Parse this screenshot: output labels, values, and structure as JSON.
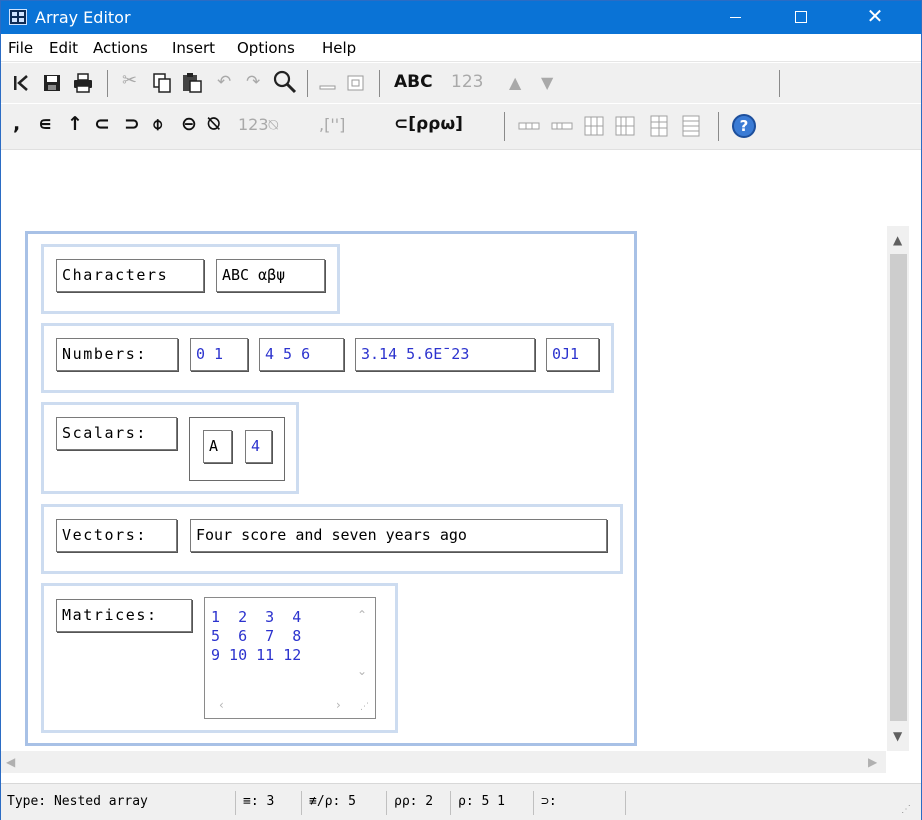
{
  "window": {
    "title": "Array Editor",
    "controls": {
      "minimize": "—",
      "maximize": "☐",
      "close": "✕"
    }
  },
  "menu": [
    "File",
    "Edit",
    "Actions",
    "Insert",
    "Options",
    "Help"
  ],
  "toolbar1": {
    "first_icon": "first-icon",
    "text_abc": "ABC",
    "text_123": "123",
    "up_icon": "▲",
    "down_icon": "▼"
  },
  "toolbar2": {
    "glyphs": [
      ",",
      "∊",
      "↑",
      "⊂",
      "⊃",
      "⌽",
      "⊖",
      "⍉"
    ],
    "num_fmt": "123⍉",
    "quote_fmt": ",['']",
    "bracket_fmt": "⊂[⍴⍴⍵]",
    "help_icon": "?"
  },
  "editor": {
    "characters": {
      "label": "Characters",
      "value": "ABC αβψ"
    },
    "numbers": {
      "label": "Numbers:",
      "values": [
        "0 1",
        "4 5 6",
        "3.14 5.6E¯23",
        "0J1"
      ]
    },
    "scalars": {
      "label": "Scalars:",
      "values": [
        "A",
        "4"
      ]
    },
    "vectors": {
      "label": "Vectors:",
      "value": "Four score and seven years ago"
    },
    "matrices": {
      "label": "Matrices:",
      "rows": [
        "1  2  3  4",
        "5  6  7  8",
        "9 10 11 12"
      ]
    }
  },
  "status": {
    "type": "Type: Nested array",
    "depth": "≡: 3",
    "tally": "≢/⍴: 5",
    "rank": "⍴⍴: 2",
    "shape": "⍴: 5 1",
    "first": "⊃:"
  },
  "colors": {
    "titlebar": "#0a73d6",
    "data_blue": "#2c33ce",
    "outer_border": "#a8c1e6",
    "inner_border": "#cddcf0"
  }
}
